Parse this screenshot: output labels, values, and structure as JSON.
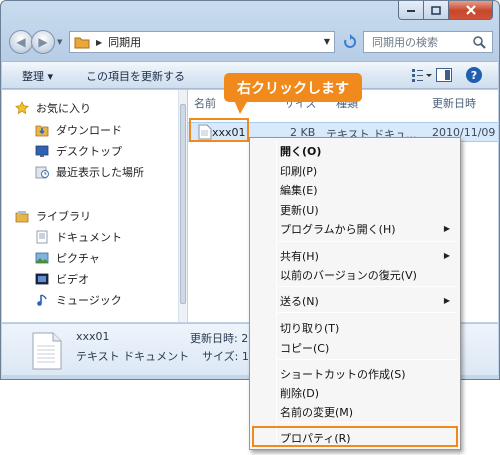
{
  "address": {
    "path": "同期用",
    "search_placeholder": "同期用の検索"
  },
  "toolbar": {
    "organize": "整理 ▾",
    "update": "この項目を更新する"
  },
  "nav": {
    "favorites": "お気に入り",
    "fav_items": [
      "ダウンロード",
      "デスクトップ",
      "最近表示した場所"
    ],
    "libraries": "ライブラリ",
    "lib_items": [
      "ドキュメント",
      "ピクチャ",
      "ビデオ",
      "ミュージック"
    ]
  },
  "columns": {
    "name": "名前",
    "size": "サイズ",
    "type": "種類",
    "date": "更新日時"
  },
  "file": {
    "name": "xxx01",
    "size": "2 KB",
    "type": "テキスト ドキュ...",
    "date": "2010/11/09"
  },
  "details": {
    "name": "xxx01",
    "type": "テキスト ドキュメント",
    "date_label": "更新日時: 2",
    "size_label": "サイズ: 1"
  },
  "callout": "右クリックします",
  "context_menu": [
    "開く(O)",
    "印刷(P)",
    "編集(E)",
    "更新(U)",
    "プログラムから開く(H)",
    "共有(H)",
    "以前のバージョンの復元(V)",
    "送る(N)",
    "切り取り(T)",
    "コピー(C)",
    "ショートカットの作成(S)",
    "削除(D)",
    "名前の変更(M)",
    "プロパティ(R)"
  ],
  "colors": {
    "highlight": "#f08a1c",
    "selection": "#d8e9fb"
  }
}
